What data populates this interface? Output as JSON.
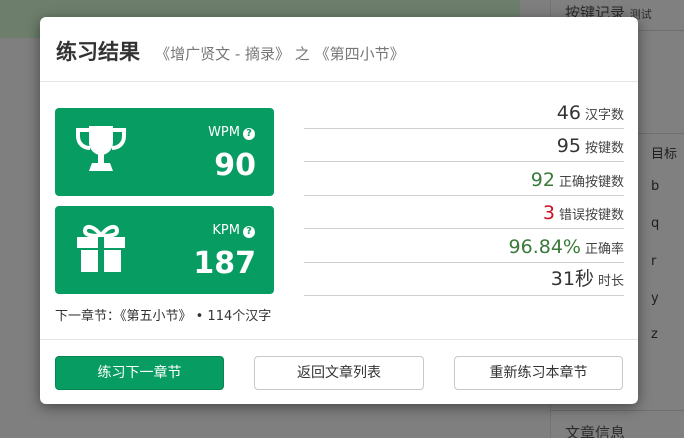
{
  "background": {
    "panel_title": "按键记录",
    "panel_title_small": "测试",
    "column_header": "目标",
    "keys": [
      "b",
      "q",
      "r",
      "y",
      "z"
    ],
    "footer_title": "文章信息"
  },
  "modal": {
    "title": "练习结果",
    "subtitle": "《增广贤文 - 摘录》 之 《第四小节》",
    "wpm": {
      "label": "WPM",
      "value": "90",
      "icon": "trophy-icon"
    },
    "kpm": {
      "label": "KPM",
      "value": "187",
      "icon": "gift-icon"
    },
    "help_glyph": "?",
    "next_chapter": "下一章节：《第五小节》 • 114个汉字",
    "stats": [
      {
        "value": "46",
        "unit": "汉字数"
      },
      {
        "value": "95",
        "unit": "按键数"
      },
      {
        "value": "92",
        "unit": "正确按键数"
      },
      {
        "value": "3",
        "unit": "错误按键数"
      },
      {
        "value": "96.84%",
        "unit": "正确率"
      },
      {
        "value": "31秒",
        "unit": "时长"
      }
    ],
    "buttons": {
      "next": "练习下一章节",
      "back": "返回文章列表",
      "redo": "重新练习本章节"
    }
  },
  "colors": {
    "brand_green": "#079c62",
    "accent_green_text": "#3a7a3a",
    "error_red": "#cc1122"
  }
}
